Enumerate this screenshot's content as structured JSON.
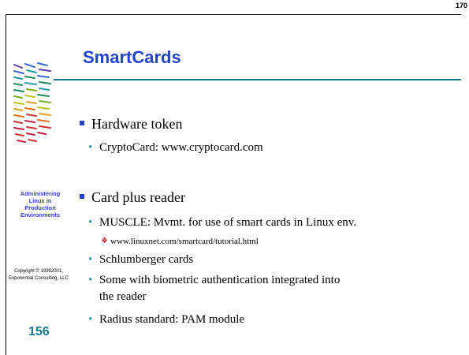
{
  "page_number": "170",
  "title": "SmartCards",
  "sidebar": {
    "course_lines": [
      "Administering",
      "Linux in",
      "Production",
      "Environments"
    ],
    "copyright_lines": [
      "Copyright © 19992001,",
      "Exponential Consulting, LLC"
    ],
    "slide_number": "156"
  },
  "bullets": [
    {
      "text": "Hardware token",
      "subitems": [
        {
          "text": "CryptoCard: www.cryptocard.com",
          "subitems": []
        }
      ]
    },
    {
      "text": "Card plus reader",
      "subitems": [
        {
          "text": "MUSCLE: Mvmt. for use of smart cards in Linux env.",
          "subitems": [
            "www.linuxnet.com/smartcard/tutorial.html"
          ]
        },
        {
          "text": "Schlumberger cards",
          "subitems": []
        },
        {
          "text_lines": [
            "Some with biometric authentication integrated into",
            "the reader"
          ],
          "subitems": []
        },
        {
          "text": "Radius standard: PAM module",
          "subitems": []
        }
      ]
    }
  ],
  "colors": {
    "title": "#2244cc",
    "rule": "#1a7a8c",
    "bullet_square": "#2244cc",
    "bullet_dot": "#2a9aaa",
    "bullet_diamond": "#cc2222",
    "slide_number": "#1a7a8c"
  }
}
